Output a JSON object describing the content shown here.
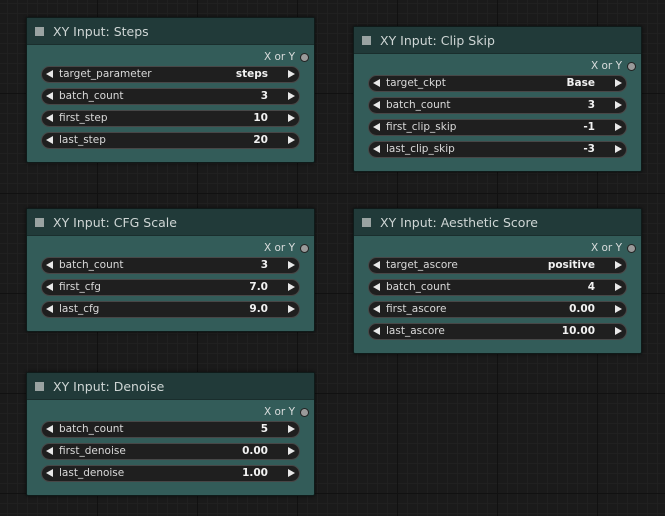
{
  "nodes": {
    "steps": {
      "title": "XY Input: Steps",
      "output_label": "X or Y",
      "widgets": [
        {
          "label": "target_parameter",
          "value": "steps"
        },
        {
          "label": "batch_count",
          "value": "3"
        },
        {
          "label": "first_step",
          "value": "10"
        },
        {
          "label": "last_step",
          "value": "20"
        }
      ]
    },
    "clip_skip": {
      "title": "XY Input: Clip Skip",
      "output_label": "X or Y",
      "widgets": [
        {
          "label": "target_ckpt",
          "value": "Base"
        },
        {
          "label": "batch_count",
          "value": "3"
        },
        {
          "label": "first_clip_skip",
          "value": "-1"
        },
        {
          "label": "last_clip_skip",
          "value": "-3"
        }
      ]
    },
    "cfg_scale": {
      "title": "XY Input: CFG Scale",
      "output_label": "X or Y",
      "widgets": [
        {
          "label": "batch_count",
          "value": "3"
        },
        {
          "label": "first_cfg",
          "value": "7.0"
        },
        {
          "label": "last_cfg",
          "value": "9.0"
        }
      ]
    },
    "aesthetic_score": {
      "title": "XY Input: Aesthetic Score",
      "output_label": "X or Y",
      "widgets": [
        {
          "label": "target_ascore",
          "value": "positive"
        },
        {
          "label": "batch_count",
          "value": "4"
        },
        {
          "label": "first_ascore",
          "value": "0.00"
        },
        {
          "label": "last_ascore",
          "value": "10.00"
        }
      ]
    },
    "denoise": {
      "title": "XY Input: Denoise",
      "output_label": "X or Y",
      "widgets": [
        {
          "label": "batch_count",
          "value": "5"
        },
        {
          "label": "first_denoise",
          "value": "0.00"
        },
        {
          "label": "last_denoise",
          "value": "1.00"
        }
      ]
    }
  },
  "colors": {
    "node_body": "#335c59",
    "node_header": "#213a39",
    "canvas": "#1a1a1a",
    "widget_bg": "#1f1f1f"
  }
}
